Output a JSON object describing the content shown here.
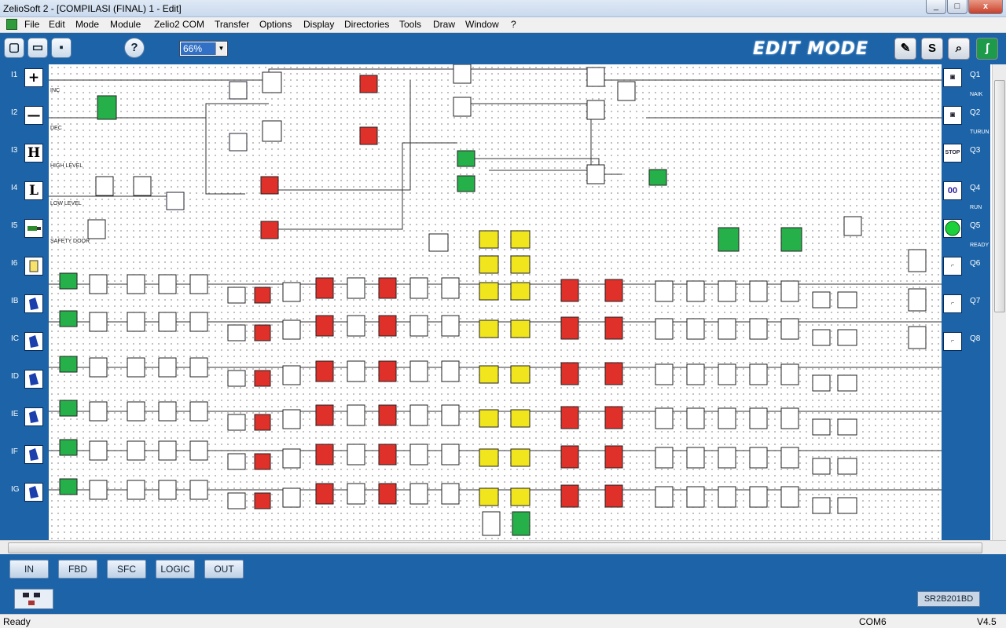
{
  "window": {
    "title": "ZelioSoft 2 - [COMPILASI (FINAL) 1 - Edit]"
  },
  "menu": [
    "File",
    "Edit",
    "Mode",
    "Module",
    "Zelio2 COM",
    "Transfer",
    "Options",
    "Display",
    "Directories",
    "Tools",
    "Draw",
    "Window",
    "?"
  ],
  "toolbar": {
    "zoom": "66%",
    "mode": "EDIT MODE",
    "help": "?",
    "s_button": "S"
  },
  "inputs": [
    {
      "id": "I1",
      "glyph": "+",
      "label": "INC"
    },
    {
      "id": "I2",
      "glyph": "—",
      "label": "DEC"
    },
    {
      "id": "I3",
      "glyph": "H",
      "label": "HIGH LEVEL"
    },
    {
      "id": "I4",
      "glyph": "L",
      "label": "LOW LEVEL"
    },
    {
      "id": "I5",
      "glyph": "",
      "label": "SAFETY DOOR"
    },
    {
      "id": "I6",
      "glyph": "",
      "label": ""
    },
    {
      "id": "IB",
      "glyph": "",
      "label": ""
    },
    {
      "id": "IC",
      "glyph": "",
      "label": ""
    },
    {
      "id": "ID",
      "glyph": "",
      "label": ""
    },
    {
      "id": "IE",
      "glyph": "",
      "label": ""
    },
    {
      "id": "IF",
      "glyph": "",
      "label": ""
    },
    {
      "id": "IG",
      "glyph": "",
      "label": ""
    }
  ],
  "outputs": [
    {
      "id": "Q1",
      "label": "NAIK"
    },
    {
      "id": "Q2",
      "label": "TURUN"
    },
    {
      "id": "Q3",
      "label": ""
    },
    {
      "id": "Q4",
      "label": "RUN"
    },
    {
      "id": "Q5",
      "label": "READY"
    },
    {
      "id": "Q6",
      "label": ""
    },
    {
      "id": "Q7",
      "label": ""
    },
    {
      "id": "Q8",
      "label": ""
    }
  ],
  "tabs": [
    "IN",
    "FBD",
    "SFC",
    "LOGIC",
    "OUT"
  ],
  "module": "SR2B201BD",
  "status": {
    "left": "Ready",
    "com": "COM6",
    "version": "V4.5"
  },
  "colors": {
    "panel": "#1c63a8",
    "block_green": "#25b04a",
    "block_red": "#e0302a",
    "block_yellow": "#f1e51d"
  }
}
